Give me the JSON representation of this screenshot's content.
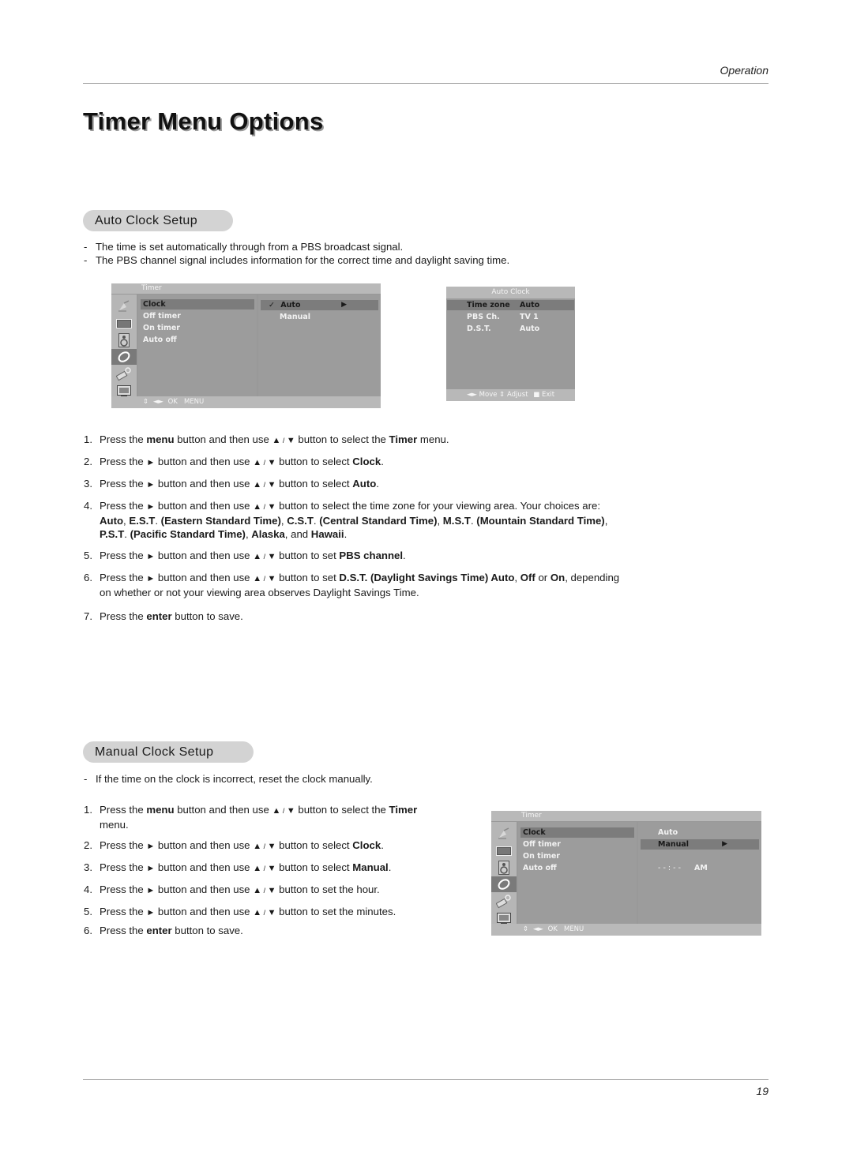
{
  "header": {
    "section_label": "Operation",
    "page_number": "19"
  },
  "page_title": "Timer Menu Options",
  "auto_clock": {
    "heading": "Auto Clock Setup",
    "bullets": [
      "The time is set automatically through from a PBS broadcast signal.",
      "The PBS channel signal includes information for the correct time and daylight saving time."
    ],
    "steps": [
      {
        "n": "1.",
        "parts": [
          [
            "t",
            "Press the "
          ],
          [
            "b",
            "menu"
          ],
          [
            "t",
            " button and then use "
          ],
          [
            "tri",
            "▲"
          ],
          [
            "sl",
            " / "
          ],
          [
            "tri",
            "▼"
          ],
          [
            "t",
            "  button to select the "
          ],
          [
            "b",
            "Timer"
          ],
          [
            "t",
            " menu."
          ]
        ]
      },
      {
        "n": "2.",
        "parts": [
          [
            "t",
            "Press the "
          ],
          [
            "tri",
            "►"
          ],
          [
            "t",
            "  button and then use "
          ],
          [
            "tri",
            "▲"
          ],
          [
            "sl",
            " / "
          ],
          [
            "tri",
            "▼"
          ],
          [
            "t",
            " button to select "
          ],
          [
            "b",
            "Clock"
          ],
          [
            "t",
            "."
          ]
        ]
      },
      {
        "n": "3.",
        "parts": [
          [
            "t",
            "Press the "
          ],
          [
            "tri",
            "►"
          ],
          [
            "t",
            "  button and then use "
          ],
          [
            "tri",
            "▲"
          ],
          [
            "sl",
            " / "
          ],
          [
            "tri",
            "▼"
          ],
          [
            "t",
            " button to select "
          ],
          [
            "b",
            "Auto"
          ],
          [
            "t",
            "."
          ]
        ]
      },
      {
        "n": "4.",
        "parts": [
          [
            "t",
            "Press the "
          ],
          [
            "tri",
            "►"
          ],
          [
            "t",
            "  button and then use "
          ],
          [
            "tri",
            "▲"
          ],
          [
            "sl",
            " / "
          ],
          [
            "tri",
            "▼"
          ],
          [
            "t",
            " button to select the time zone for your viewing area. Your choices are:"
          ],
          [
            "br",
            ""
          ],
          [
            "b",
            "Auto"
          ],
          [
            "t",
            ", "
          ],
          [
            "b",
            "E.S.T"
          ],
          [
            "t",
            ". "
          ],
          [
            "b",
            "(Eastern Standard Time)"
          ],
          [
            "t",
            ", "
          ],
          [
            "b",
            "C.S.T"
          ],
          [
            "t",
            ". "
          ],
          [
            "b",
            "(Central Standard Time)"
          ],
          [
            "t",
            ", "
          ],
          [
            "b",
            "M.S.T"
          ],
          [
            "t",
            ". "
          ],
          [
            "b",
            "(Mountain  Standard Time)"
          ],
          [
            "t",
            ","
          ],
          [
            "br",
            ""
          ],
          [
            "b",
            "P.S.T"
          ],
          [
            "t",
            ". "
          ],
          [
            "b",
            "(Pacific Standard Time)"
          ],
          [
            "t",
            ", "
          ],
          [
            "b",
            "Alaska"
          ],
          [
            "t",
            ", and  "
          ],
          [
            "b",
            "Hawaii"
          ],
          [
            "t",
            "."
          ]
        ]
      },
      {
        "n": "5.",
        "parts": [
          [
            "t",
            "Press the "
          ],
          [
            "tri",
            "►"
          ],
          [
            "t",
            "  button and then use "
          ],
          [
            "tri",
            "▲"
          ],
          [
            "sl",
            " / "
          ],
          [
            "tri",
            "▼"
          ],
          [
            "t",
            " button to set "
          ],
          [
            "b",
            "PBS channel"
          ],
          [
            "t",
            "."
          ]
        ]
      },
      {
        "n": "6.",
        "parts": [
          [
            "t",
            "Press the "
          ],
          [
            "tri",
            "►"
          ],
          [
            "t",
            "  button and then use "
          ],
          [
            "tri",
            "▲"
          ],
          [
            "sl",
            " / "
          ],
          [
            "tri",
            "▼"
          ],
          [
            "t",
            " button to set "
          ],
          [
            "b",
            "D.S.T. (Daylight Savings Time) Auto"
          ],
          [
            "t",
            ", "
          ],
          [
            "b",
            "Off"
          ],
          [
            "t",
            " or "
          ],
          [
            "b",
            "On"
          ],
          [
            "t",
            ", depending"
          ],
          [
            "br",
            ""
          ],
          [
            "t",
            "on whether or not your viewing area observes Daylight Savings Time."
          ]
        ]
      },
      {
        "n": "7.",
        "parts": [
          [
            "t",
            "Press the "
          ],
          [
            "b",
            "enter"
          ],
          [
            "t",
            " button to save."
          ]
        ]
      }
    ],
    "timer_menu": {
      "title": "Timer",
      "items": [
        "Clock",
        "Off timer",
        "On timer",
        "Auto off"
      ],
      "selected_item": "Clock",
      "options": [
        {
          "label": "Auto",
          "checked": true,
          "selected": true
        },
        {
          "label": "Manual",
          "checked": false,
          "selected": false
        }
      ],
      "footer": "OK   MENU",
      "icons": [
        "antenna-icon",
        "picture-icon",
        "speaker-icon",
        "timer-icon",
        "settings-icon",
        "pc-icon"
      ],
      "active_icon": "timer-icon"
    },
    "auto_clock_menu": {
      "title": "Auto Clock",
      "rows": [
        {
          "label": "Time zone",
          "value": "Auto",
          "selected": true
        },
        {
          "label": "PBS Ch.",
          "value": "TV 1",
          "selected": false
        },
        {
          "label": "D.S.T.",
          "value": "Auto",
          "selected": false
        }
      ],
      "footer": {
        "move": "Move",
        "adjust": "Adjust",
        "exit": "Exit"
      }
    }
  },
  "manual_clock": {
    "heading": "Manual Clock Setup",
    "bullets": [
      "If the time on the clock is incorrect, reset the clock manually."
    ],
    "steps": [
      {
        "n": "1.",
        "parts": [
          [
            "t",
            "Press the "
          ],
          [
            "b",
            "menu"
          ],
          [
            "t",
            " button and then use "
          ],
          [
            "tri",
            "▲"
          ],
          [
            "sl",
            " / "
          ],
          [
            "tri",
            "▼"
          ],
          [
            "t",
            "  button to select the "
          ],
          [
            "b",
            "Timer"
          ],
          [
            "br",
            ""
          ],
          [
            "t",
            "menu."
          ]
        ]
      },
      {
        "n": "2.",
        "parts": [
          [
            "t",
            "Press the "
          ],
          [
            "tri",
            "►"
          ],
          [
            "t",
            "  button and then use "
          ],
          [
            "tri",
            "▲"
          ],
          [
            "sl",
            " / "
          ],
          [
            "tri",
            "▼"
          ],
          [
            "t",
            " button to select "
          ],
          [
            "b",
            "Clock"
          ],
          [
            "t",
            "."
          ]
        ]
      },
      {
        "n": "3.",
        "parts": [
          [
            "t",
            "Press the "
          ],
          [
            "tri",
            "►"
          ],
          [
            "t",
            "  button and then use "
          ],
          [
            "tri",
            "▲"
          ],
          [
            "sl",
            " / "
          ],
          [
            "tri",
            "▼"
          ],
          [
            "t",
            " button to select "
          ],
          [
            "b",
            "Manual"
          ],
          [
            "t",
            "."
          ]
        ]
      },
      {
        "n": "4.",
        "parts": [
          [
            "t",
            "Press the "
          ],
          [
            "tri",
            "►"
          ],
          [
            "t",
            "  button and then use "
          ],
          [
            "tri",
            "▲"
          ],
          [
            "sl",
            " / "
          ],
          [
            "tri",
            "▼"
          ],
          [
            "t",
            " button to set the hour."
          ]
        ]
      },
      {
        "n": "5.",
        "parts": [
          [
            "t",
            "Press the "
          ],
          [
            "tri",
            "►"
          ],
          [
            "t",
            "  button and then use "
          ],
          [
            "tri",
            "▲"
          ],
          [
            "sl",
            " / "
          ],
          [
            "tri",
            "▼"
          ],
          [
            "t",
            " button to set the minutes."
          ]
        ]
      },
      {
        "n": "6.",
        "parts": [
          [
            "t",
            "Press the "
          ],
          [
            "b",
            "enter"
          ],
          [
            "t",
            " button to save."
          ]
        ]
      }
    ],
    "timer_menu": {
      "title": "Timer",
      "items": [
        "Clock",
        "Off timer",
        "On timer",
        "Auto off"
      ],
      "selected_item": "Clock",
      "options": [
        {
          "label": "Auto",
          "checked": false,
          "selected": false
        },
        {
          "label": "Manual",
          "checked": false,
          "selected": true
        }
      ],
      "time_display": "- - : - -",
      "ampm": "AM",
      "footer": "OK   MENU",
      "icons": [
        "antenna-icon",
        "picture-icon",
        "speaker-icon",
        "timer-icon",
        "settings-icon",
        "pc-icon"
      ],
      "active_icon": "timer-icon"
    }
  }
}
